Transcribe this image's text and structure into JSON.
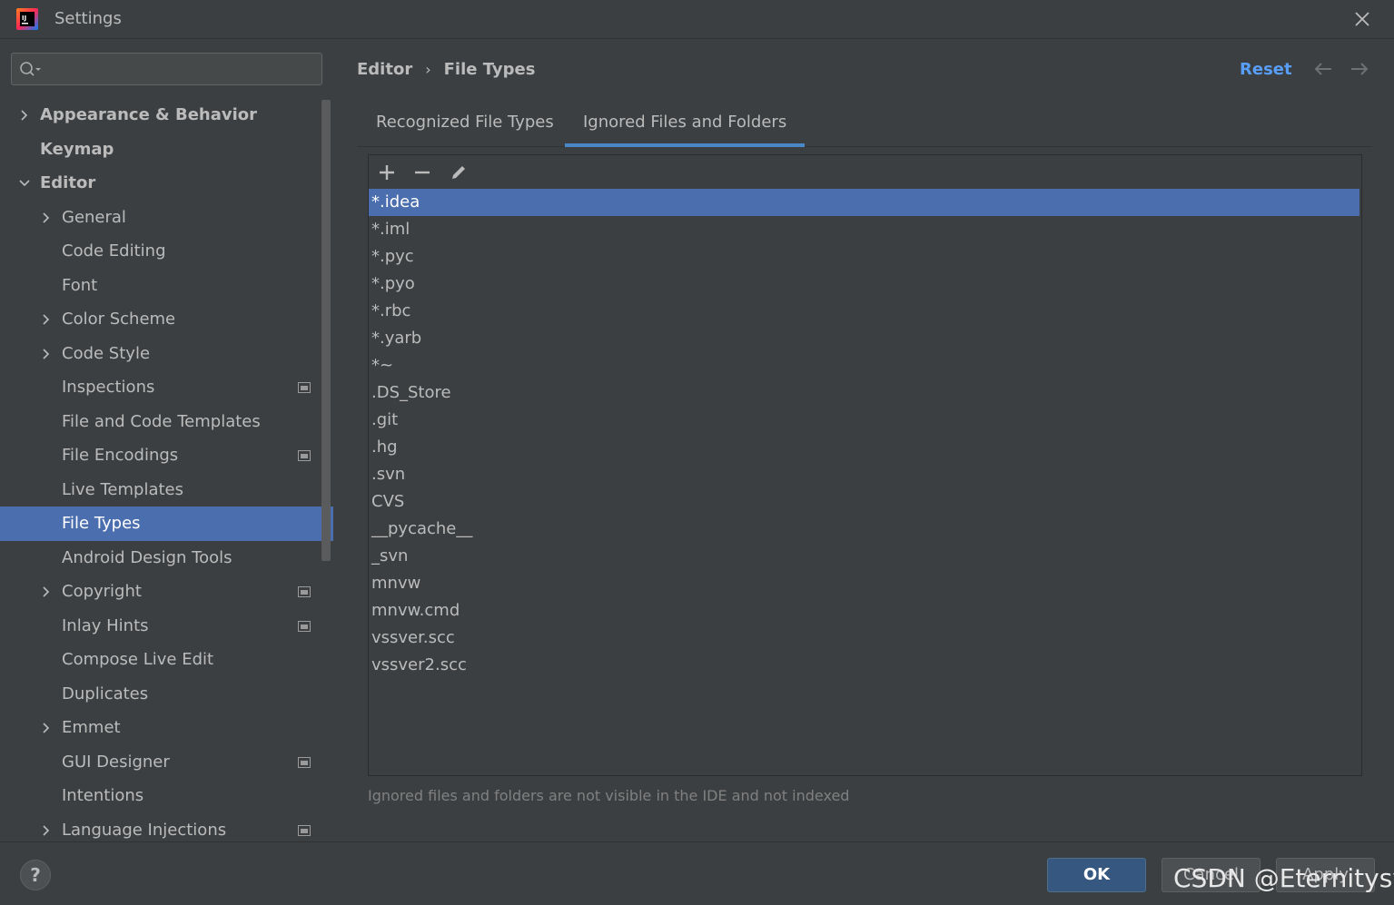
{
  "window": {
    "title": "Settings"
  },
  "search": {
    "placeholder": "",
    "value": ""
  },
  "sidebar": {
    "items": [
      {
        "label": "Appearance & Behavior",
        "level": 0,
        "expandable": true,
        "expanded": false,
        "bold": true,
        "project_icon": false,
        "selected": false
      },
      {
        "label": "Keymap",
        "level": 0,
        "expandable": false,
        "expanded": false,
        "bold": true,
        "project_icon": false,
        "selected": false
      },
      {
        "label": "Editor",
        "level": 0,
        "expandable": true,
        "expanded": true,
        "bold": true,
        "project_icon": false,
        "selected": false
      },
      {
        "label": "General",
        "level": 1,
        "expandable": true,
        "expanded": false,
        "bold": false,
        "project_icon": false,
        "selected": false
      },
      {
        "label": "Code Editing",
        "level": 1,
        "expandable": false,
        "expanded": false,
        "bold": false,
        "project_icon": false,
        "selected": false
      },
      {
        "label": "Font",
        "level": 1,
        "expandable": false,
        "expanded": false,
        "bold": false,
        "project_icon": false,
        "selected": false
      },
      {
        "label": "Color Scheme",
        "level": 1,
        "expandable": true,
        "expanded": false,
        "bold": false,
        "project_icon": false,
        "selected": false
      },
      {
        "label": "Code Style",
        "level": 1,
        "expandable": true,
        "expanded": false,
        "bold": false,
        "project_icon": false,
        "selected": false
      },
      {
        "label": "Inspections",
        "level": 1,
        "expandable": false,
        "expanded": false,
        "bold": false,
        "project_icon": true,
        "selected": false
      },
      {
        "label": "File and Code Templates",
        "level": 1,
        "expandable": false,
        "expanded": false,
        "bold": false,
        "project_icon": false,
        "selected": false
      },
      {
        "label": "File Encodings",
        "level": 1,
        "expandable": false,
        "expanded": false,
        "bold": false,
        "project_icon": true,
        "selected": false
      },
      {
        "label": "Live Templates",
        "level": 1,
        "expandable": false,
        "expanded": false,
        "bold": false,
        "project_icon": false,
        "selected": false
      },
      {
        "label": "File Types",
        "level": 1,
        "expandable": false,
        "expanded": false,
        "bold": false,
        "project_icon": false,
        "selected": true
      },
      {
        "label": "Android Design Tools",
        "level": 1,
        "expandable": false,
        "expanded": false,
        "bold": false,
        "project_icon": false,
        "selected": false
      },
      {
        "label": "Copyright",
        "level": 1,
        "expandable": true,
        "expanded": false,
        "bold": false,
        "project_icon": true,
        "selected": false
      },
      {
        "label": "Inlay Hints",
        "level": 1,
        "expandable": false,
        "expanded": false,
        "bold": false,
        "project_icon": true,
        "selected": false
      },
      {
        "label": "Compose Live Edit",
        "level": 1,
        "expandable": false,
        "expanded": false,
        "bold": false,
        "project_icon": false,
        "selected": false
      },
      {
        "label": "Duplicates",
        "level": 1,
        "expandable": false,
        "expanded": false,
        "bold": false,
        "project_icon": false,
        "selected": false
      },
      {
        "label": "Emmet",
        "level": 1,
        "expandable": true,
        "expanded": false,
        "bold": false,
        "project_icon": false,
        "selected": false
      },
      {
        "label": "GUI Designer",
        "level": 1,
        "expandable": false,
        "expanded": false,
        "bold": false,
        "project_icon": true,
        "selected": false
      },
      {
        "label": "Intentions",
        "level": 1,
        "expandable": false,
        "expanded": false,
        "bold": false,
        "project_icon": false,
        "selected": false
      },
      {
        "label": "Language Injections",
        "level": 1,
        "expandable": true,
        "expanded": false,
        "bold": false,
        "project_icon": true,
        "selected": false
      }
    ]
  },
  "main": {
    "breadcrumb": {
      "parent": "Editor",
      "separator": "›",
      "current": "File Types"
    },
    "reset_label": "Reset",
    "tabs": [
      {
        "label": "Recognized File Types",
        "active": false
      },
      {
        "label": "Ignored Files and Folders",
        "active": true
      }
    ],
    "toolbar": {
      "add_icon": "plus-icon",
      "remove_icon": "minus-icon",
      "edit_icon": "pencil-icon"
    },
    "ignored_patterns": [
      "*.idea",
      "*.iml",
      "*.pyc",
      "*.pyo",
      "*.rbc",
      "*.yarb",
      "*~",
      ".DS_Store",
      ".git",
      ".hg",
      ".svn",
      "CVS",
      "__pycache__",
      "_svn",
      "mnvw",
      "mnvw.cmd",
      "vssver.scc",
      "vssver2.scc"
    ],
    "selected_pattern": "*.idea",
    "hint": "Ignored files and folders are not visible in the IDE and not indexed"
  },
  "footer": {
    "help_label": "?",
    "ok_label": "OK",
    "cancel_label": "Cancel",
    "apply_label": "Apply"
  },
  "watermark": "CSDN @Eternitysy",
  "colors": {
    "accent": "#4b6eaf",
    "link": "#589df6",
    "background": "#3c3f41",
    "text": "#bbbbbb"
  }
}
